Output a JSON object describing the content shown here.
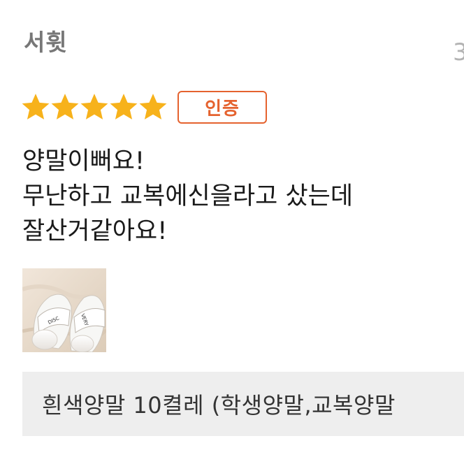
{
  "review": {
    "reviewer_name": "서휫",
    "date_partial": "3",
    "rating": 5,
    "rating_max": 5,
    "star_color": "#f7b21b",
    "badge_label": "인증",
    "badge_color": "#e5622e",
    "body_lines": [
      "양말이뻐요!",
      "무난하고 교복에신을라고 샀는데",
      "잘산거같아요!"
    ],
    "photo": {
      "icon": "slippers-socks-photo",
      "caption": "",
      "logo_text": "DISCOVERY"
    },
    "product_name": "흰색양말 10켤레 (학생양말,교복양말"
  }
}
